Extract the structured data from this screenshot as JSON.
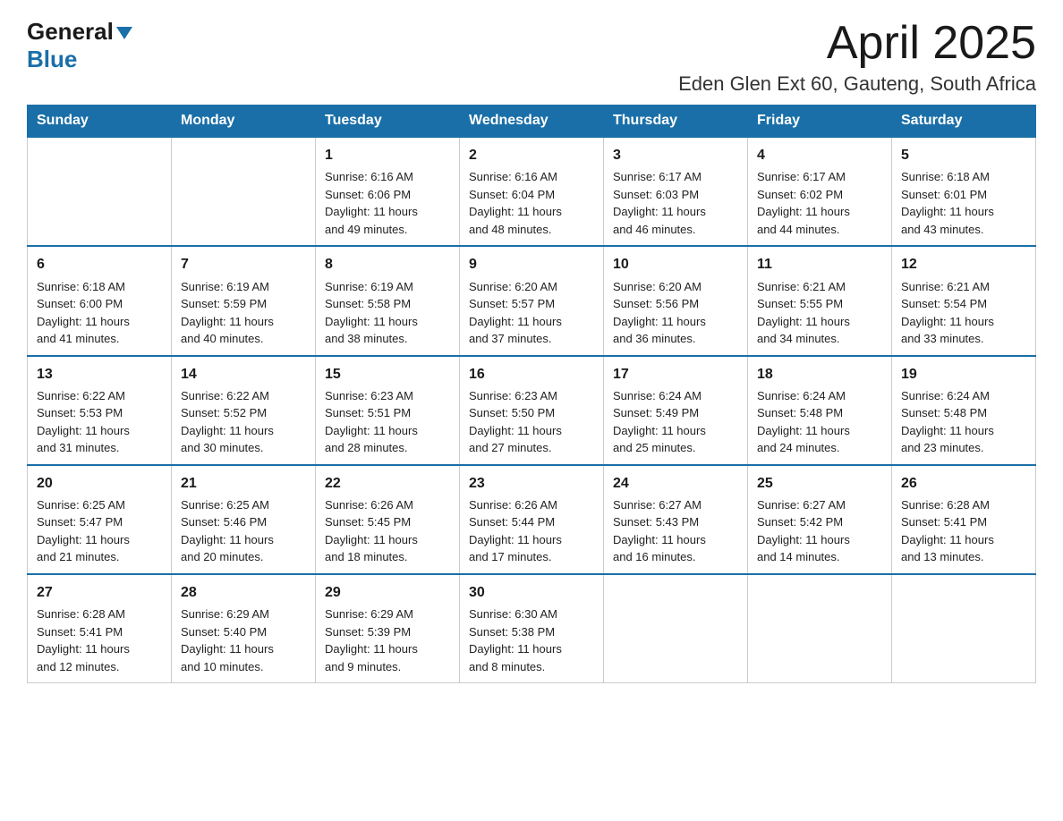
{
  "header": {
    "logo_general": "General",
    "logo_blue": "Blue",
    "title": "April 2025",
    "location": "Eden Glen Ext 60, Gauteng, South Africa"
  },
  "weekdays": [
    "Sunday",
    "Monday",
    "Tuesday",
    "Wednesday",
    "Thursday",
    "Friday",
    "Saturday"
  ],
  "weeks": [
    [
      {
        "day": "",
        "info": ""
      },
      {
        "day": "",
        "info": ""
      },
      {
        "day": "1",
        "info": "Sunrise: 6:16 AM\nSunset: 6:06 PM\nDaylight: 11 hours\nand 49 minutes."
      },
      {
        "day": "2",
        "info": "Sunrise: 6:16 AM\nSunset: 6:04 PM\nDaylight: 11 hours\nand 48 minutes."
      },
      {
        "day": "3",
        "info": "Sunrise: 6:17 AM\nSunset: 6:03 PM\nDaylight: 11 hours\nand 46 minutes."
      },
      {
        "day": "4",
        "info": "Sunrise: 6:17 AM\nSunset: 6:02 PM\nDaylight: 11 hours\nand 44 minutes."
      },
      {
        "day": "5",
        "info": "Sunrise: 6:18 AM\nSunset: 6:01 PM\nDaylight: 11 hours\nand 43 minutes."
      }
    ],
    [
      {
        "day": "6",
        "info": "Sunrise: 6:18 AM\nSunset: 6:00 PM\nDaylight: 11 hours\nand 41 minutes."
      },
      {
        "day": "7",
        "info": "Sunrise: 6:19 AM\nSunset: 5:59 PM\nDaylight: 11 hours\nand 40 minutes."
      },
      {
        "day": "8",
        "info": "Sunrise: 6:19 AM\nSunset: 5:58 PM\nDaylight: 11 hours\nand 38 minutes."
      },
      {
        "day": "9",
        "info": "Sunrise: 6:20 AM\nSunset: 5:57 PM\nDaylight: 11 hours\nand 37 minutes."
      },
      {
        "day": "10",
        "info": "Sunrise: 6:20 AM\nSunset: 5:56 PM\nDaylight: 11 hours\nand 36 minutes."
      },
      {
        "day": "11",
        "info": "Sunrise: 6:21 AM\nSunset: 5:55 PM\nDaylight: 11 hours\nand 34 minutes."
      },
      {
        "day": "12",
        "info": "Sunrise: 6:21 AM\nSunset: 5:54 PM\nDaylight: 11 hours\nand 33 minutes."
      }
    ],
    [
      {
        "day": "13",
        "info": "Sunrise: 6:22 AM\nSunset: 5:53 PM\nDaylight: 11 hours\nand 31 minutes."
      },
      {
        "day": "14",
        "info": "Sunrise: 6:22 AM\nSunset: 5:52 PM\nDaylight: 11 hours\nand 30 minutes."
      },
      {
        "day": "15",
        "info": "Sunrise: 6:23 AM\nSunset: 5:51 PM\nDaylight: 11 hours\nand 28 minutes."
      },
      {
        "day": "16",
        "info": "Sunrise: 6:23 AM\nSunset: 5:50 PM\nDaylight: 11 hours\nand 27 minutes."
      },
      {
        "day": "17",
        "info": "Sunrise: 6:24 AM\nSunset: 5:49 PM\nDaylight: 11 hours\nand 25 minutes."
      },
      {
        "day": "18",
        "info": "Sunrise: 6:24 AM\nSunset: 5:48 PM\nDaylight: 11 hours\nand 24 minutes."
      },
      {
        "day": "19",
        "info": "Sunrise: 6:24 AM\nSunset: 5:48 PM\nDaylight: 11 hours\nand 23 minutes."
      }
    ],
    [
      {
        "day": "20",
        "info": "Sunrise: 6:25 AM\nSunset: 5:47 PM\nDaylight: 11 hours\nand 21 minutes."
      },
      {
        "day": "21",
        "info": "Sunrise: 6:25 AM\nSunset: 5:46 PM\nDaylight: 11 hours\nand 20 minutes."
      },
      {
        "day": "22",
        "info": "Sunrise: 6:26 AM\nSunset: 5:45 PM\nDaylight: 11 hours\nand 18 minutes."
      },
      {
        "day": "23",
        "info": "Sunrise: 6:26 AM\nSunset: 5:44 PM\nDaylight: 11 hours\nand 17 minutes."
      },
      {
        "day": "24",
        "info": "Sunrise: 6:27 AM\nSunset: 5:43 PM\nDaylight: 11 hours\nand 16 minutes."
      },
      {
        "day": "25",
        "info": "Sunrise: 6:27 AM\nSunset: 5:42 PM\nDaylight: 11 hours\nand 14 minutes."
      },
      {
        "day": "26",
        "info": "Sunrise: 6:28 AM\nSunset: 5:41 PM\nDaylight: 11 hours\nand 13 minutes."
      }
    ],
    [
      {
        "day": "27",
        "info": "Sunrise: 6:28 AM\nSunset: 5:41 PM\nDaylight: 11 hours\nand 12 minutes."
      },
      {
        "day": "28",
        "info": "Sunrise: 6:29 AM\nSunset: 5:40 PM\nDaylight: 11 hours\nand 10 minutes."
      },
      {
        "day": "29",
        "info": "Sunrise: 6:29 AM\nSunset: 5:39 PM\nDaylight: 11 hours\nand 9 minutes."
      },
      {
        "day": "30",
        "info": "Sunrise: 6:30 AM\nSunset: 5:38 PM\nDaylight: 11 hours\nand 8 minutes."
      },
      {
        "day": "",
        "info": ""
      },
      {
        "day": "",
        "info": ""
      },
      {
        "day": "",
        "info": ""
      }
    ]
  ]
}
